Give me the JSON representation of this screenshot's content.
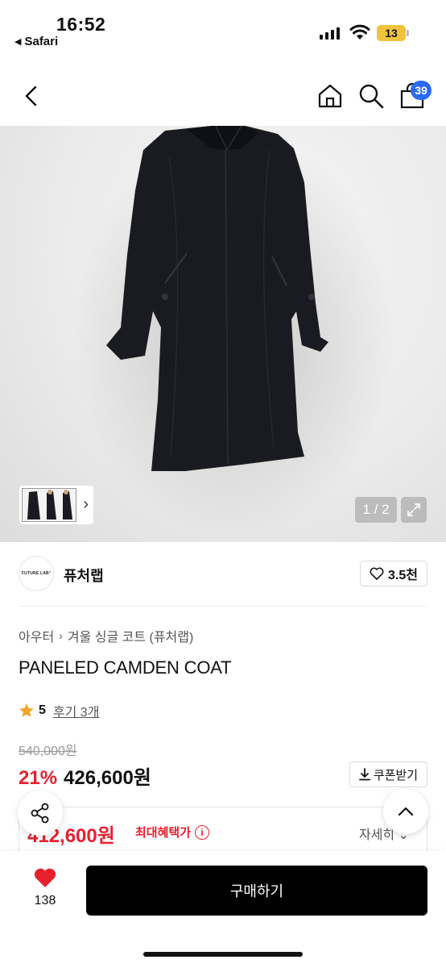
{
  "status_bar": {
    "time": "16:52",
    "back_app": "Safari",
    "battery": "13"
  },
  "header": {
    "cart_count": "39",
    "icons": [
      "back-icon",
      "home-icon",
      "search-icon",
      "shopping-bag-icon"
    ]
  },
  "gallery": {
    "pager": "1 / 2"
  },
  "brand": {
    "logo_text": "FUTURE LAB°",
    "name": "퓨처랩",
    "likes": "3.5천"
  },
  "breadcrumb": {
    "category": "아우터",
    "subcategory": "겨울 싱글 코트 (퓨처랩)"
  },
  "product": {
    "title": "PANELED CAMDEN COAT",
    "rating": "5",
    "reviews": "후기 3개",
    "original_price": "540,000원",
    "discount": "21%",
    "price": "426,600원",
    "coupon_label": "쿠폰받기"
  },
  "benefit": {
    "price": "412,600원",
    "label": "최대혜택가",
    "detail": "자세히 ⌄"
  },
  "bottom": {
    "like_count": "138",
    "buy_label": "구매하기"
  },
  "colors": {
    "accent_red": "#e8202e",
    "badge_blue": "#2a6bf2",
    "star": "#f2a52b"
  }
}
